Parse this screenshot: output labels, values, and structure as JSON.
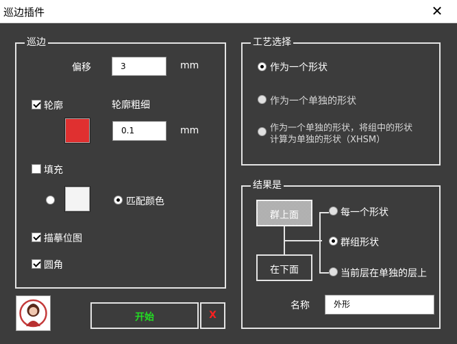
{
  "window": {
    "title": "巡边插件",
    "close_glyph": "✕"
  },
  "patrol": {
    "legend": "巡边",
    "offset_label": "偏移",
    "offset_value": "3",
    "offset_unit": "mm",
    "outline_label": "轮廓",
    "outline_checked": true,
    "outline_width_label": "轮廓粗细",
    "outline_color": "#e03030",
    "outline_width_value": "0.1",
    "outline_width_unit": "mm",
    "fill_label": "填充",
    "fill_checked": false,
    "fill_color": "#f4f4f4",
    "match_color_label": "匹配颜色",
    "trace_bitmap_label": "描摹位图",
    "trace_bitmap_checked": true,
    "rounded_label": "圆角",
    "rounded_checked": true
  },
  "process": {
    "legend": "工艺选择",
    "options": [
      {
        "label": "作为一个形状",
        "selected": true
      },
      {
        "label": "作为一个单独的形状",
        "selected": false
      },
      {
        "label_line1": "作为一个单独的形状，将组中的形状",
        "label_line2": "计算为单独的形状（XHSM）",
        "selected": false
      }
    ]
  },
  "result": {
    "legend": "结果是",
    "top_button": "群上面",
    "bottom_button": "在下面",
    "options": [
      {
        "label": "每一个形状",
        "selected": false
      },
      {
        "label": "群组形状",
        "selected": true
      },
      {
        "label": "当前层在单独的层上",
        "selected": false
      }
    ],
    "name_label": "名称",
    "name_value": "外形"
  },
  "actions": {
    "start": "开始",
    "cancel": "X",
    "start_color": "#22dd22",
    "cancel_color": "#ff2020"
  },
  "icons": {
    "avatar": "avatar-icon"
  }
}
